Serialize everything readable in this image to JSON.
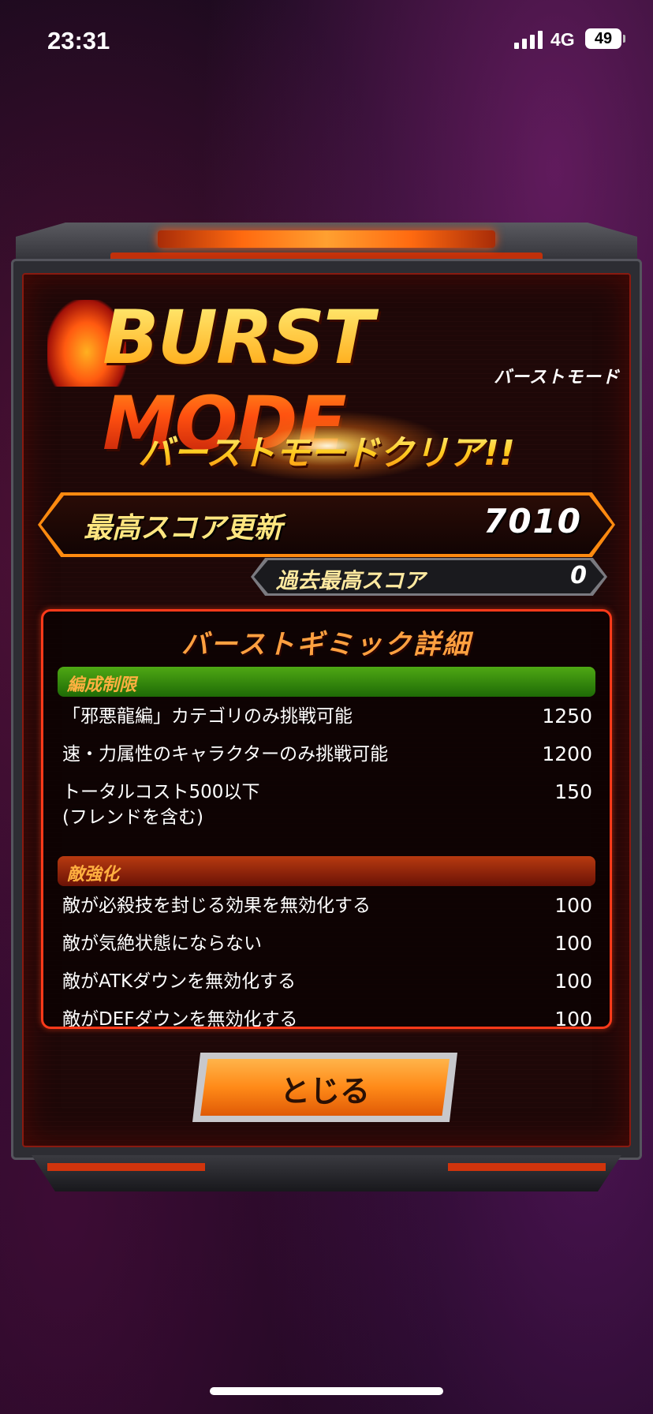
{
  "status_bar": {
    "time": "23:31",
    "network": "4G",
    "battery": "49"
  },
  "logo": {
    "title": "BURST MODE",
    "subtitle": "バーストモード"
  },
  "result": {
    "clear_text": "バーストモードクリア!!"
  },
  "best_score": {
    "label": "最高スコア更新",
    "value": "7010"
  },
  "past_best": {
    "label": "過去最高スコア",
    "value": "0"
  },
  "details": {
    "title": "バーストギミック詳細",
    "sections": [
      {
        "header": "編成制限",
        "items": [
          {
            "name": "「邪悪龍編」カテゴリのみ挑戦可能",
            "points": "1250"
          },
          {
            "name": "速・力属性のキャラクターのみ挑戦可能",
            "points": "1200"
          },
          {
            "name": "トータルコスト500以下",
            "name2": "(フレンドを含む)",
            "points": "150"
          }
        ]
      },
      {
        "header": "敵強化",
        "items": [
          {
            "name": "敵が必殺技を封じる効果を無効化する",
            "points": "100"
          },
          {
            "name": "敵が気絶状態にならない",
            "points": "100"
          },
          {
            "name": "敵がATKダウンを無効化する",
            "points": "100"
          },
          {
            "name": "敵がDEFダウンを無効化する",
            "points": "100"
          }
        ]
      }
    ]
  },
  "close_button": {
    "label": "とじる"
  },
  "colors": {
    "accent": "#ff8a18",
    "frame_red": "#ff3a1a",
    "gold": "#ffd43a"
  }
}
